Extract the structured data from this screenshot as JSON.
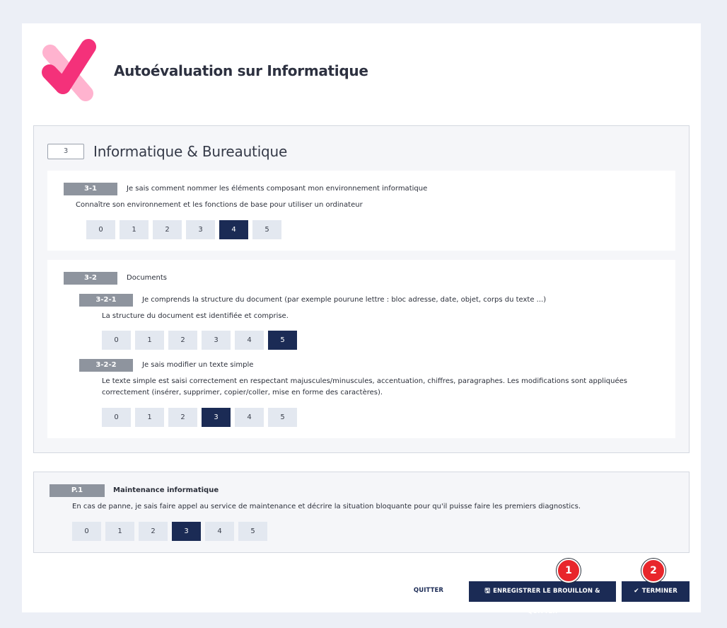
{
  "header": {
    "title": "Autoévaluation sur Informatique"
  },
  "section": {
    "number": "3",
    "title": "Informatique & Bureautique",
    "items": [
      {
        "code": "3-1",
        "label": "Je sais comment nommer les éléments composant mon environnement informatique",
        "description": "Connaître son environnement et les fonctions de base pour utiliser un ordinateur",
        "scale": [
          "0",
          "1",
          "2",
          "3",
          "4",
          "5"
        ],
        "selected": "4"
      },
      {
        "code": "3-2",
        "label": "Documents",
        "subitems": [
          {
            "code": "3-2-1",
            "label": "Je comprends la structure du document (par exemple pourune lettre : bloc adresse, date, objet, corps du texte ...)",
            "description": "La structure du document est identifiée et comprise.",
            "scale": [
              "0",
              "1",
              "2",
              "3",
              "4",
              "5"
            ],
            "selected": "5"
          },
          {
            "code": "3-2-2",
            "label": "Je sais modifier un texte simple",
            "description_line1": "Le texte simple est saisi correctement en respectant majuscules/minuscules, accentuation, chiffres, paragraphes. Les modifications sont appliquées",
            "description_line2": "correctement (insérer, supprimer, copier/coller, mise en forme des caractères).",
            "scale": [
              "0",
              "1",
              "2",
              "3",
              "4",
              "5"
            ],
            "selected": "3"
          }
        ]
      }
    ]
  },
  "pro_section": {
    "code": "P.1",
    "label": "Maintenance informatique",
    "description": "En cas de panne, je sais faire appel au service de maintenance et décrire la situation bloquante pour qu'il puisse faire les premiers diagnostics.",
    "scale": [
      "0",
      "1",
      "2",
      "3",
      "4",
      "5"
    ],
    "selected": "3"
  },
  "footer": {
    "quit_label": "QUITTER",
    "save_label": "ENREGISTRER LE BROUILLON & QUITTER",
    "save_icon": "floppy-disk-icon",
    "finish_label": "TERMINER",
    "finish_icon": "check-icon"
  },
  "markers": [
    "1",
    "2"
  ],
  "colors": {
    "primary": "#1b2b55",
    "logo_pink": "#f4317a",
    "logo_light_pink": "#ffb3cf",
    "marker_red": "#e8262b",
    "badge_gray": "#8e949e",
    "scale_bg": "#e3e8f0"
  }
}
